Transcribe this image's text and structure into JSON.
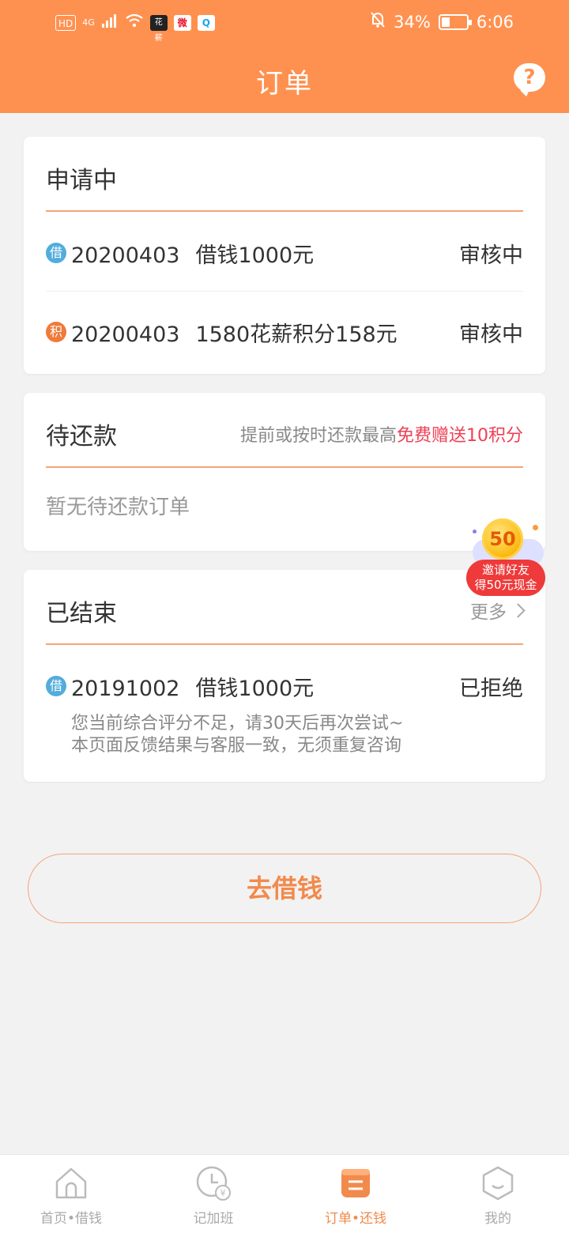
{
  "status_bar": {
    "network": "4G",
    "chip_hd": "HD",
    "app_icon": "花薪",
    "weibo_icon": "微",
    "qq_icon": "Q",
    "battery_percent": "34%",
    "battery_level": 0.34,
    "time": "6:06"
  },
  "header": {
    "title": "订单",
    "help_icon": "?"
  },
  "applying": {
    "title": "申请中",
    "items": [
      {
        "badge": "借",
        "badge_color": "#52acdc",
        "date": "20200403",
        "desc": "借钱1000元",
        "status": "审核中"
      },
      {
        "badge": "积",
        "badge_color": "#f07a3a",
        "date": "20200403",
        "desc": "1580花薪积分158元",
        "status": "审核中"
      }
    ]
  },
  "pending": {
    "title": "待还款",
    "note_prefix": "提前或按时还款最高",
    "note_highlight": "免费赠送10积分",
    "empty_text": "暂无待还款订单"
  },
  "finished": {
    "title": "已结束",
    "more": "更多",
    "items": [
      {
        "badge": "借",
        "badge_color": "#52acdc",
        "date": "20191002",
        "desc": "借钱1000元",
        "status": "已拒绝",
        "sub1": "您当前综合评分不足，请30天后再次尝试~",
        "sub2": "本页面反馈结果与客服一致，无须重复咨询"
      }
    ]
  },
  "promo": {
    "coin": "50",
    "line1": "邀请好友",
    "line2": "得50元现金"
  },
  "cta": {
    "label": "去借钱"
  },
  "tabs": [
    {
      "label": "首页•借钱",
      "icon": "home-icon",
      "active": false
    },
    {
      "label": "记加班",
      "icon": "clock-yen-icon",
      "active": false
    },
    {
      "label": "订单•还钱",
      "icon": "order-list-icon",
      "active": true
    },
    {
      "label": "我的",
      "icon": "profile-face-icon",
      "active": false
    }
  ],
  "colors": {
    "brand": "#ff9150",
    "accent_text": "#f28a4b",
    "highlight": "#ee4055"
  }
}
